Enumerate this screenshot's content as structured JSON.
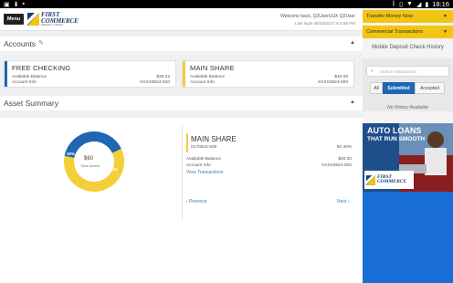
{
  "status_bar": {
    "time": "18:16"
  },
  "header": {
    "menu_label": "Menu",
    "logo_line1": "FIRST",
    "logo_line2": "COMMERCE",
    "logo_line3": "CREDIT UNION",
    "welcome": "Welcome back, Q2UserUUX Q2User",
    "last_login": "Last login 06/23/2017 at 5:55 PM"
  },
  "accounts": {
    "title": "Accounts",
    "cards": [
      {
        "name": "FREE CHECKING",
        "balance_label": "Available Balance",
        "balance": "$28.22",
        "info_label": "Account Info",
        "info": "XXXX0524-520",
        "color": "#1f66b3"
      },
      {
        "name": "MAIN SHARE",
        "balance_label": "Available Balance",
        "balance": "$40.00",
        "info_label": "Account Info",
        "info": "XXXX0524-500",
        "color": "#f3cf3a"
      }
    ]
  },
  "asset_summary": {
    "title": "Asset Summary",
    "chart": {
      "center_value": "$60",
      "center_label": "Total Assets",
      "slices": [
        {
          "label": "40%",
          "value": 40,
          "color": "#1f66b3"
        },
        {
          "label": "60%",
          "value": 60,
          "color": "#f3cf3a"
        }
      ]
    },
    "detail": {
      "name": "MAIN SHARE",
      "number": "0170524-500",
      "percent": "60.40%",
      "balance_label": "Available Balance",
      "balance": "$40.00",
      "info_label": "Account Info",
      "info": "XXXX0524-500",
      "view_link": "View Transactions"
    },
    "prev": "Previous",
    "next": "Next"
  },
  "sidebar": {
    "btn1": "Transfer Money Now",
    "btn2": "Commercial Transactions",
    "title": "Mobile Deposit Check History",
    "search_placeholder": "Search transactions",
    "tabs": [
      "All",
      "Submitted",
      "Accepted"
    ],
    "active_tab": "Submitted",
    "empty_text": "No History Available",
    "ad_line1": "AUTO LOANS",
    "ad_line2": "THAT RUN SMOOTH",
    "ad_logo1": "FIRST",
    "ad_logo2": "COMMERCE"
  }
}
